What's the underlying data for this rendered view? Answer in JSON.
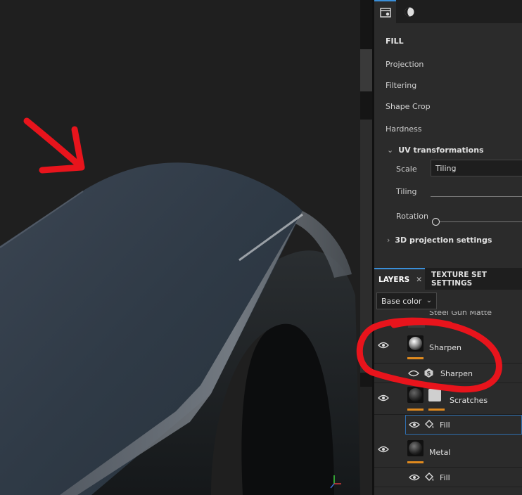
{
  "panel_tabs": [
    {
      "icon": "properties-panel-icon",
      "active": true
    },
    {
      "icon": "material-ball-icon",
      "active": false
    }
  ],
  "properties": {
    "heading": "FILL",
    "items": [
      "Projection",
      "Filtering",
      "Shape Crop",
      "Hardness"
    ],
    "uv_section": "UV transformations",
    "scale_label": "Scale",
    "scale_value": "Tiling",
    "tiling_label": "Tiling",
    "rotation_label": "Rotation",
    "projection_section": "3D projection settings"
  },
  "layers": {
    "tab_layers": "LAYERS",
    "tab_texture_set": "TEXTURE SET SETTINGS",
    "channel": "Base color",
    "partial_layer": "Steel Gun Matte",
    "rows": [
      {
        "name": "Sharpen",
        "type": "layer"
      },
      {
        "name": "Sharpen",
        "type": "effect",
        "effect_icon": "smart-filter-icon"
      },
      {
        "name": "Scratches",
        "type": "layer"
      },
      {
        "name": "Fill",
        "type": "effect",
        "effect_icon": "fill-bucket-icon",
        "selected": true
      },
      {
        "name": "Metal",
        "type": "layer"
      },
      {
        "name": "Fill",
        "type": "effect",
        "effect_icon": "fill-bucket-icon"
      }
    ]
  },
  "colors": {
    "annotation": "#e8141c",
    "accent": "#3a8fd9",
    "orange": "#e08a1e"
  }
}
